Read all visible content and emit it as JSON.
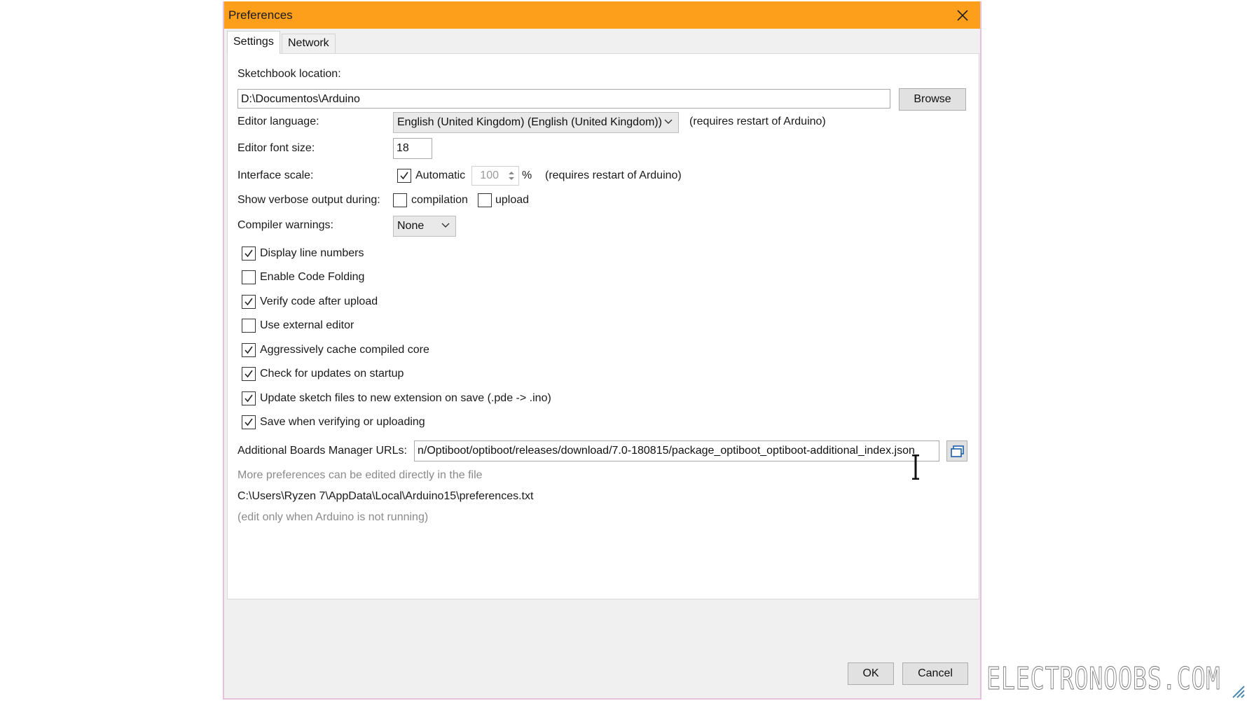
{
  "window": {
    "title": "Preferences"
  },
  "tabs": [
    {
      "label": "Settings",
      "active": true
    },
    {
      "label": "Network",
      "active": false
    }
  ],
  "settings": {
    "sketchbook_label": "Sketchbook location:",
    "sketchbook_value": "D:\\Documentos\\Arduino",
    "browse_label": "Browse",
    "editor_language_label": "Editor language:",
    "editor_language_value": "English (United Kingdom) (English (United Kingdom))",
    "restart_note": "(requires restart of Arduino)",
    "font_size_label": "Editor font size:",
    "font_size_value": "18",
    "interface_scale_label": "Interface scale:",
    "automatic_label": "Automatic",
    "automatic_checked": true,
    "scale_value": "100",
    "percent": "%",
    "verbose_label": "Show verbose output during:",
    "compilation_label": "compilation",
    "upload_label": "upload",
    "compiler_warnings_label": "Compiler warnings:",
    "compiler_warnings_value": "None",
    "options": [
      {
        "label": "Display line numbers",
        "checked": true
      },
      {
        "label": "Enable Code Folding",
        "checked": false
      },
      {
        "label": "Verify code after upload",
        "checked": true
      },
      {
        "label": "Use external editor",
        "checked": false
      },
      {
        "label": "Aggressively cache compiled core",
        "checked": true
      },
      {
        "label": "Check for updates on startup",
        "checked": true
      },
      {
        "label": "Update sketch files to new extension on save (.pde -> .ino)",
        "checked": true
      },
      {
        "label": "Save when verifying or uploading",
        "checked": true
      }
    ],
    "boards_urls_label": "Additional Boards Manager URLs:",
    "boards_urls_value": "n/Optiboot/optiboot/releases/download/7.0-180815/package_optiboot_optiboot-additional_index.json",
    "more_prefs_note": "More preferences can be edited directly in the file",
    "prefs_path": "C:\\Users\\Ryzen 7\\AppData\\Local\\Arduino15\\preferences.txt",
    "edit_note": "(edit only when Arduino is not running)"
  },
  "footer": {
    "ok_label": "OK",
    "cancel_label": "Cancel"
  },
  "watermark": "ELECTRONOOBS.COM",
  "colors": {
    "titlebar": "#fd9f1a",
    "panel": "#ffffff",
    "dialog": "#f0f0f0"
  }
}
